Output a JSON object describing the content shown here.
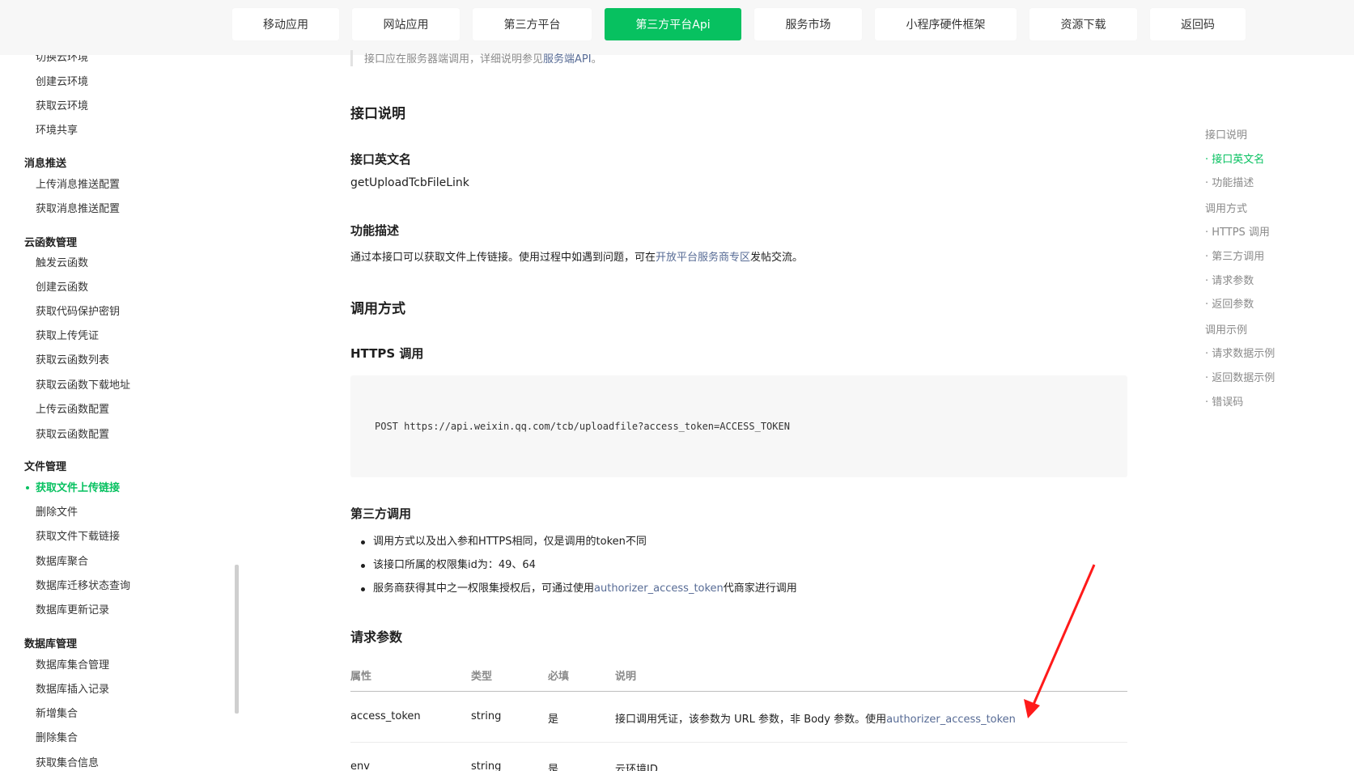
{
  "topnav": {
    "items": [
      {
        "label": "移动应用",
        "active": false
      },
      {
        "label": "网站应用",
        "active": false
      },
      {
        "label": "第三方平台",
        "active": false
      },
      {
        "label": "第三方平台Api",
        "active": true
      },
      {
        "label": "服务市场",
        "active": false
      },
      {
        "label": "小程序硬件框架",
        "active": false
      },
      {
        "label": "资源下载",
        "active": false
      },
      {
        "label": "返回码",
        "active": false
      }
    ]
  },
  "sidebar": {
    "partial_top": "切换云环境",
    "items_env": [
      "创建云环境",
      "获取云环境",
      "环境共享"
    ],
    "group_push": "消息推送",
    "items_push": [
      "上传消息推送配置",
      "获取消息推送配置"
    ],
    "group_func": "云函数管理",
    "items_func": [
      "触发云函数",
      "创建云函数",
      "获取代码保护密钥",
      "获取上传凭证",
      "获取云函数列表",
      "获取云函数下载地址",
      "上传云函数配置",
      "获取云函数配置"
    ],
    "group_file": "文件管理",
    "items_file": [
      "获取文件上传链接",
      "删除文件",
      "获取文件下载链接",
      "数据库聚合",
      "数据库迁移状态查询",
      "数据库更新记录"
    ],
    "group_db": "数据库管理",
    "items_db": [
      "数据库集合管理",
      "数据库插入记录",
      "新增集合",
      "删除集合",
      "获取集合信息"
    ]
  },
  "main": {
    "note_prefix": "接口应在服务器端调用，详细说明参见",
    "note_link": "服务端API",
    "note_suffix": "。",
    "sec_interface": "接口说明",
    "sub_name": "接口英文名",
    "api_name": "getUploadTcbFileLink",
    "sub_desc": "功能描述",
    "desc_prefix": "通过本接口可以获取文件上传链接。使用过程中如遇到问题，可在",
    "desc_link": "开放平台服务商专区",
    "desc_suffix": "发帖交流。",
    "sec_call": "调用方式",
    "sub_https": "HTTPS 调用",
    "code": "POST https://api.weixin.qq.com/tcb/uploadfile?access_token=ACCESS_TOKEN",
    "sub_third": "第三方调用",
    "bullet1": "调用方式以及出入参和HTTPS相同，仅是调用的token不同",
    "bullet2": "该接口所属的权限集id为：49、64",
    "bullet3_prefix": "服务商获得其中之一权限集授权后，可通过使用",
    "bullet3_link": "authorizer_access_token",
    "bullet3_suffix": "代商家进行调用",
    "sec_params": "请求参数",
    "table": {
      "headers": [
        "属性",
        "类型",
        "必填",
        "说明"
      ],
      "row1": {
        "name": "access_token",
        "type": "string",
        "required": "是",
        "desc_prefix": "接口调用凭证，该参数为 URL 参数，非 Body 参数。使用",
        "desc_link": "authorizer_access_token"
      },
      "row2": {
        "name": "env",
        "type": "string",
        "required": "是",
        "desc": "云环境ID"
      }
    }
  },
  "toc": {
    "items": [
      {
        "label": "接口说明",
        "level": 1,
        "active": false
      },
      {
        "label": "· 接口英文名",
        "level": 2,
        "active": true
      },
      {
        "label": "· 功能描述",
        "level": 2,
        "active": false
      },
      {
        "label": "调用方式",
        "level": 1,
        "active": false
      },
      {
        "label": "· HTTPS 调用",
        "level": 2,
        "active": false
      },
      {
        "label": "· 第三方调用",
        "level": 2,
        "active": false
      },
      {
        "label": "· 请求参数",
        "level": 2,
        "active": false
      },
      {
        "label": "· 返回参数",
        "level": 2,
        "active": false
      },
      {
        "label": "调用示例",
        "level": 1,
        "active": false
      },
      {
        "label": "· 请求数据示例",
        "level": 2,
        "active": false
      },
      {
        "label": "· 返回数据示例",
        "level": 2,
        "active": false
      },
      {
        "label": "· 错误码",
        "level": 2,
        "active": false
      }
    ]
  },
  "colors": {
    "accent": "#07c160",
    "link": "#576b95",
    "annotation_arrow": "#ff1a1a"
  }
}
